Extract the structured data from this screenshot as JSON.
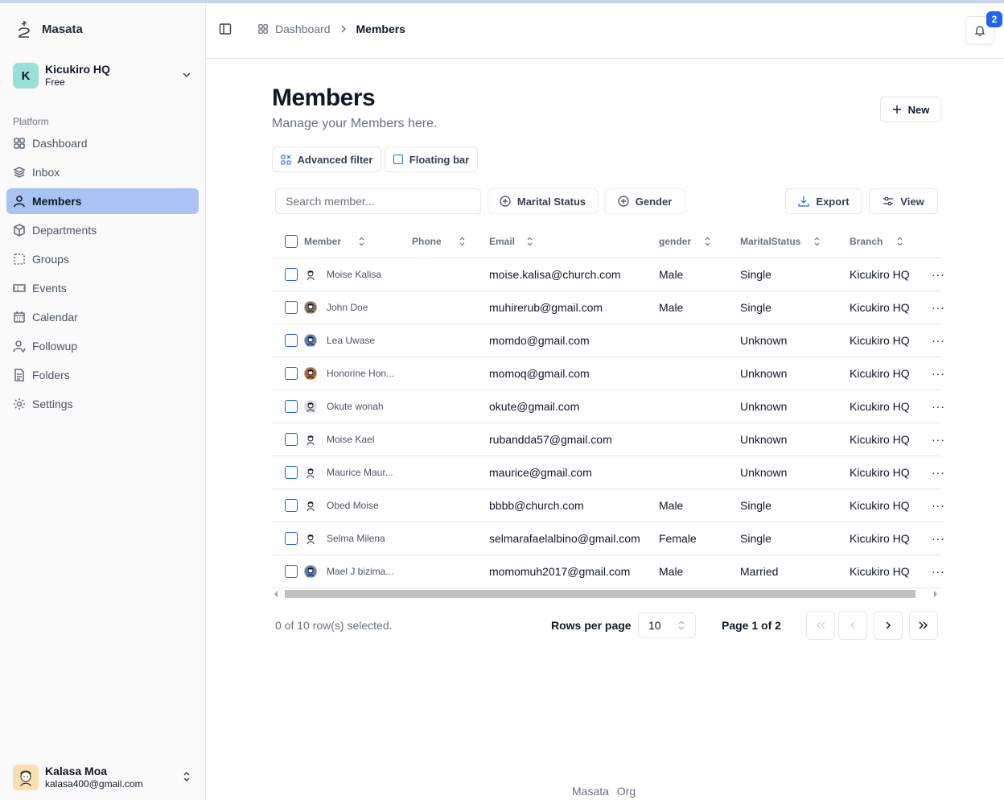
{
  "app": {
    "name": "Masata"
  },
  "org": {
    "initial": "K",
    "name": "Kicukiro HQ",
    "plan": "Free"
  },
  "sidebar": {
    "section": "Platform",
    "items": [
      {
        "label": "Dashboard",
        "icon": "grid-icon"
      },
      {
        "label": "Inbox",
        "icon": "layers-icon"
      },
      {
        "label": "Members",
        "icon": "user-icon",
        "active": true
      },
      {
        "label": "Departments",
        "icon": "box-icon"
      },
      {
        "label": "Groups",
        "icon": "dashed-square-icon"
      },
      {
        "label": "Events",
        "icon": "ticket-icon"
      },
      {
        "label": "Calendar",
        "icon": "calendar-icon"
      },
      {
        "label": "Followup",
        "icon": "user-check-icon"
      },
      {
        "label": "Folders",
        "icon": "file-icon"
      },
      {
        "label": "Settings",
        "icon": "gear-icon"
      }
    ]
  },
  "user": {
    "name": "Kalasa Moa",
    "email": "kalasa400@gmail.com"
  },
  "breadcrumb": {
    "parent": "Dashboard",
    "current": "Members"
  },
  "notifications": {
    "count": "2"
  },
  "page": {
    "title": "Members",
    "subtitle": "Manage your Members here.",
    "new_label": "New",
    "advanced_filter_label": "Advanced filter",
    "floating_bar_label": "Floating bar"
  },
  "toolbar": {
    "search_placeholder": "Search member...",
    "marital_status_label": "Marital Status",
    "gender_label": "Gender",
    "export_label": "Export",
    "view_label": "View"
  },
  "table": {
    "headers": {
      "member": "Member",
      "phone": "Phone",
      "email": "Email",
      "gender": "gender",
      "marital": "MaritalStatus",
      "branch": "Branch"
    },
    "rows": [
      {
        "name": "Moise Kalisa",
        "phone": "",
        "email": "moise.kalisa@church.com",
        "gender": "Male",
        "marital": "Single",
        "branch": "Kicukiro HQ",
        "avatar_color": "#ffffff"
      },
      {
        "name": "John Doe",
        "phone": "",
        "email": "muhirerub@gmail.com",
        "gender": "Male",
        "marital": "Single",
        "branch": "Kicukiro HQ",
        "avatar_color": "#8b6f5a"
      },
      {
        "name": "Lea Uwase",
        "phone": "",
        "email": "momdo@gmail.com",
        "gender": "",
        "marital": "Unknown",
        "branch": "Kicukiro HQ",
        "avatar_color": "#5b7db8"
      },
      {
        "name": "Honorine Hon...",
        "phone": "",
        "email": "momoq@gmail.com",
        "gender": "",
        "marital": "Unknown",
        "branch": "Kicukiro HQ",
        "avatar_color": "#b5652a"
      },
      {
        "name": "Okute wonah",
        "phone": "",
        "email": "okute@gmail.com",
        "gender": "",
        "marital": "Unknown",
        "branch": "Kicukiro HQ",
        "avatar_color": "#d9d9d9"
      },
      {
        "name": "Moise Kael",
        "phone": "",
        "email": "rubandda57@gmail.com",
        "gender": "",
        "marital": "Unknown",
        "branch": "Kicukiro HQ",
        "avatar_color": "#ffffff"
      },
      {
        "name": "Maurice Maur...",
        "phone": "",
        "email": "maurice@gmail.com",
        "gender": "",
        "marital": "Unknown",
        "branch": "Kicukiro HQ",
        "avatar_color": "#ffffff"
      },
      {
        "name": "Obed Moise",
        "phone": "",
        "email": "bbbb@church.com",
        "gender": "Male",
        "marital": "Single",
        "branch": "Kicukiro HQ",
        "avatar_color": "#ffffff"
      },
      {
        "name": "Selma Milena",
        "phone": "",
        "email": "selmarafaelalbino@gmail.com",
        "gender": "Female",
        "marital": "Single",
        "branch": "Kicukiro HQ",
        "avatar_color": "#ffffff"
      },
      {
        "name": "Mael J bizima...",
        "phone": "",
        "email": "momomuh2017@gmail.com",
        "gender": "Male",
        "marital": "Married",
        "branch": "Kicukiro HQ",
        "avatar_color": "#5b7db8"
      }
    ],
    "row_action": "···"
  },
  "pagination": {
    "selected_text": "0 of 10 row(s) selected.",
    "rows_per_page_label": "Rows per page",
    "rows_per_page_value": "10",
    "page_text": "Page 1 of 2"
  },
  "footer": {
    "text": "Masata Org"
  },
  "colors": {
    "accent": "#2563eb",
    "active_nav": "#a9c4f2",
    "org_avatar": "#9be0d6"
  }
}
